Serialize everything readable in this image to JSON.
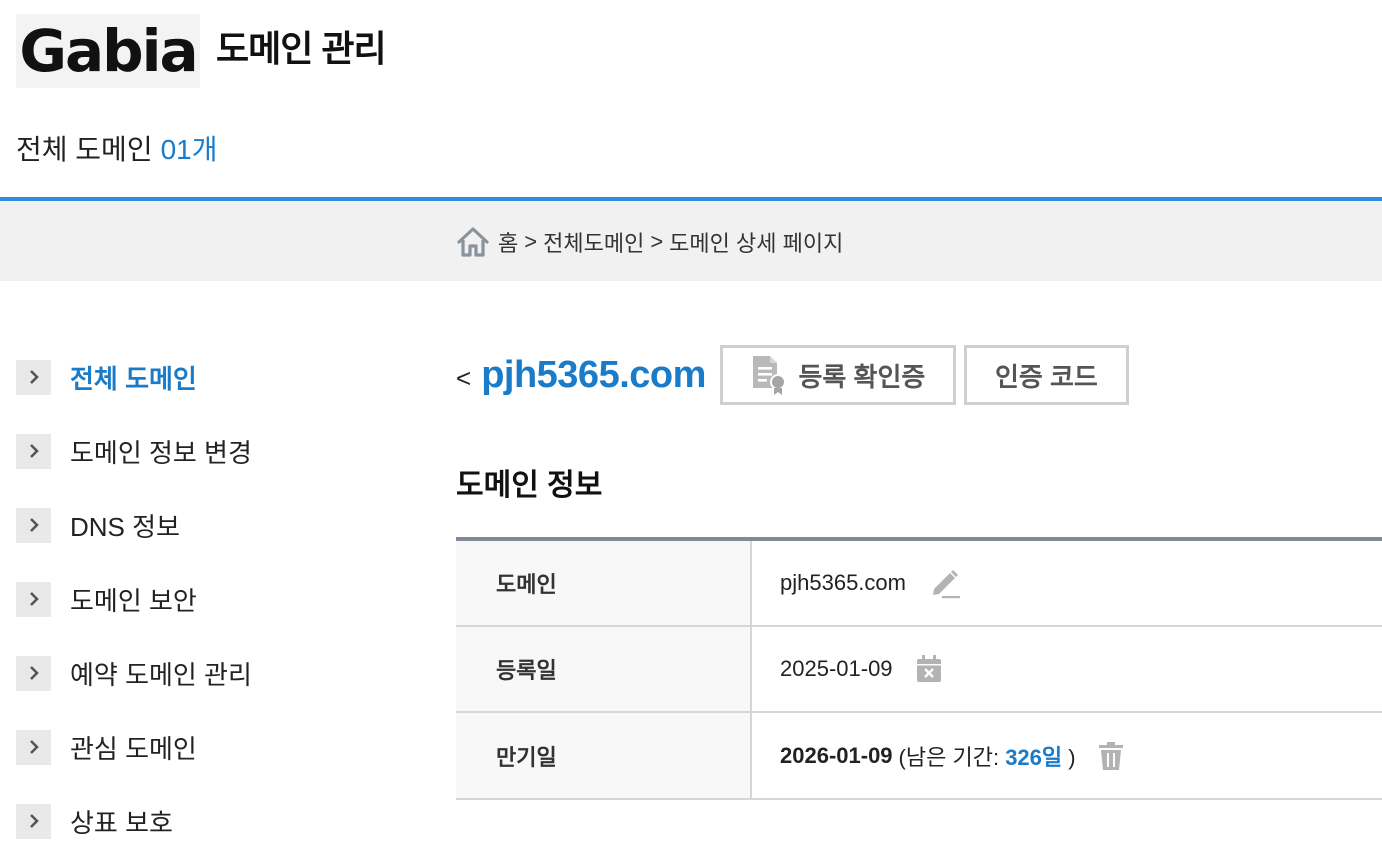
{
  "header": {
    "logo_text": "Gabia",
    "app_title": "도메인 관리",
    "total_label": "전체 도메인",
    "total_count": "01개"
  },
  "breadcrumb": {
    "home_icon": "home-icon",
    "items": [
      "홈",
      "전체도메인",
      "도메인 상세 페이지"
    ],
    "separator": ">"
  },
  "sidebar": {
    "items": [
      {
        "label": "전체 도메인",
        "active": true
      },
      {
        "label": "도메인 정보 변경",
        "active": false
      },
      {
        "label": "DNS 정보",
        "active": false
      },
      {
        "label": "도메인 보안",
        "active": false
      },
      {
        "label": "예약 도메인 관리",
        "active": false
      },
      {
        "label": "관심 도메인",
        "active": false
      },
      {
        "label": "상표 보호",
        "active": false
      }
    ]
  },
  "detail": {
    "back_symbol": "<",
    "domain": "pjh5365.com",
    "cert_button": "등록 확인증",
    "auth_button": "인증 코드",
    "section_title": "도메인 정보",
    "rows": {
      "domain": {
        "label": "도메인",
        "value": "pjh5365.com",
        "icon": "pencil-icon"
      },
      "registered": {
        "label": "등록일",
        "value": "2025-01-09",
        "icon": "calendar-icon"
      },
      "expires": {
        "label": "만기일",
        "value": "2026-01-09",
        "remaining_prefix": "(남은 기간:",
        "remaining_days": "326일",
        "remaining_suffix": ")",
        "icon": "trash-icon"
      }
    }
  },
  "colors": {
    "accent": "#1a7bc9",
    "header_rule": "#2e8ede",
    "table_top_border": "#7f8a96",
    "crumb_bg": "#f1f1f1"
  }
}
